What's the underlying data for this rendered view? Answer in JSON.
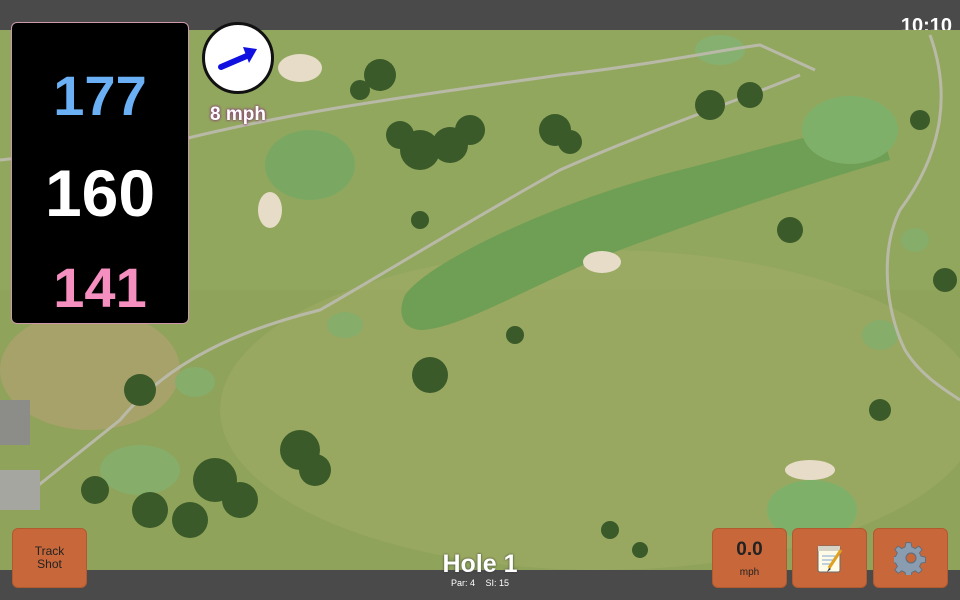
{
  "status": {
    "time": "10:10"
  },
  "distances": {
    "back": {
      "value": "177",
      "color": "#6bb0f5"
    },
    "middle": {
      "value": "160",
      "color": "#ffffff"
    },
    "front": {
      "value": "141",
      "color": "#f58fc0"
    }
  },
  "wind": {
    "speed_label": "8 mph",
    "arrow_color": "#1010e0"
  },
  "buttons": {
    "track_shot_line1": "Track",
    "track_shot_line2": "Shot",
    "speed_value": "0.0",
    "speed_unit": "mph",
    "notes_icon": "notepad-icon",
    "settings_icon": "gear-icon",
    "button_color": "#c8683a"
  },
  "hole": {
    "title": "Hole 1",
    "par_label": "Par: 4",
    "si_label": "SI: 15"
  }
}
